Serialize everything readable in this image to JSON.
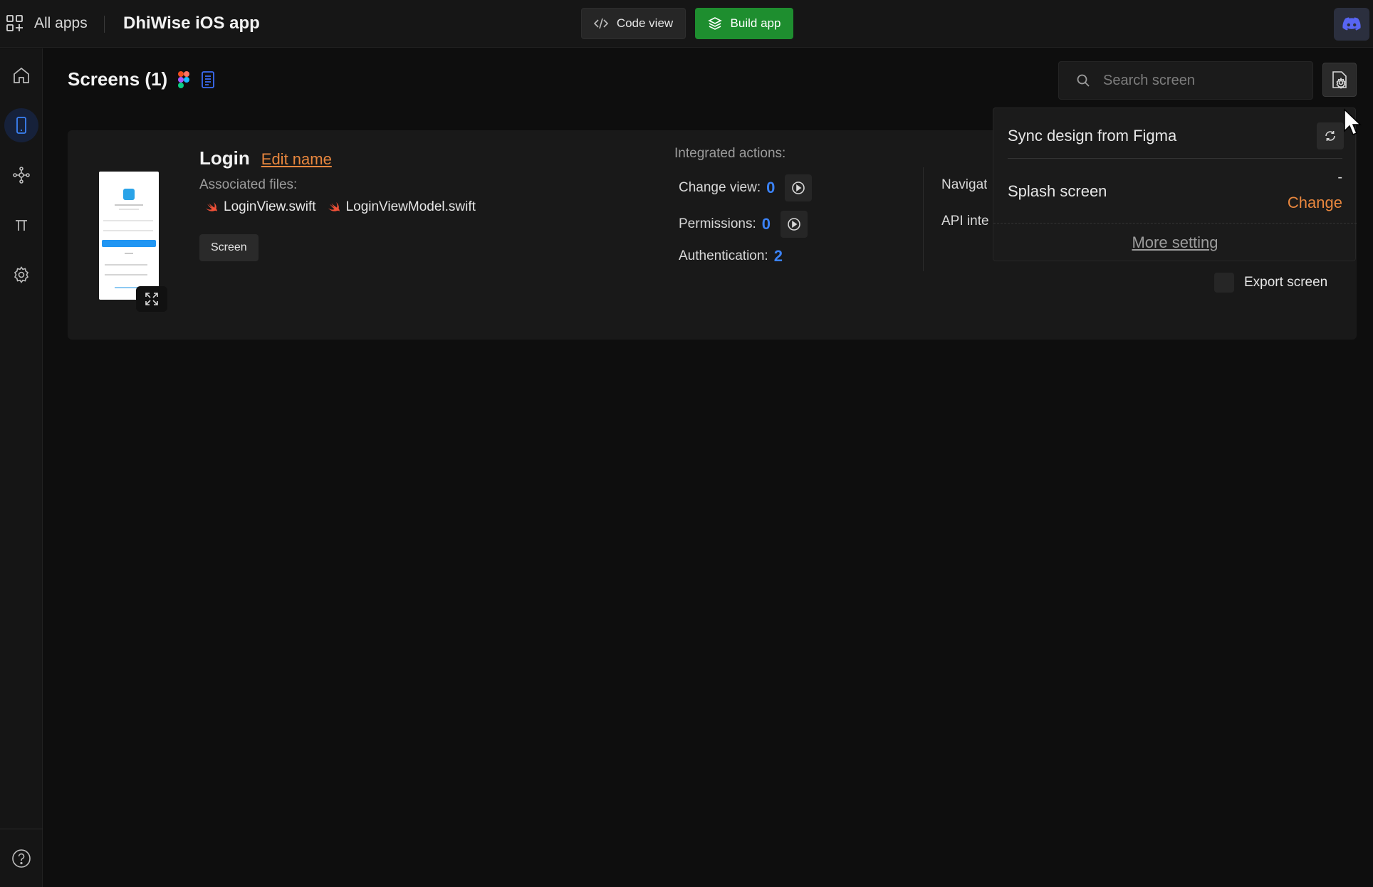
{
  "topbar": {
    "all_apps_label": "All apps",
    "app_title": "DhiWise iOS app",
    "code_view_label": "Code view",
    "build_app_label": "Build app"
  },
  "sidebar": {
    "items": [
      {
        "icon": "home-icon"
      },
      {
        "icon": "mobile-icon",
        "active": true
      },
      {
        "icon": "integration-icon"
      },
      {
        "icon": "constants-icon"
      },
      {
        "icon": "gear-icon"
      }
    ],
    "help_icon": "help-icon"
  },
  "header": {
    "title": "Screens (1)",
    "search_placeholder": "Search screen"
  },
  "screen_card": {
    "name": "Login",
    "edit_label": "Edit name",
    "associated_files_label": "Associated files:",
    "files": [
      "LoginView.swift",
      "LoginViewModel.swift"
    ],
    "tag": "Screen",
    "integrated_actions_label": "Integrated actions:",
    "actions": [
      {
        "label": "Change view:",
        "count": "0"
      },
      {
        "label": "Permissions:",
        "count": "0"
      },
      {
        "label": "Authentication:",
        "count": "2"
      }
    ],
    "col2": [
      "Navigat",
      "API inte"
    ],
    "export_label": "Export screen"
  },
  "dropdown": {
    "sync_label": "Sync design from Figma",
    "splash_label": "Splash screen",
    "splash_value": "-",
    "change_label": "Change",
    "more_setting_label": "More setting"
  },
  "colors": {
    "accent_orange": "#e9873e",
    "accent_blue": "#3b82f6",
    "build_green": "#1e8e2f"
  }
}
